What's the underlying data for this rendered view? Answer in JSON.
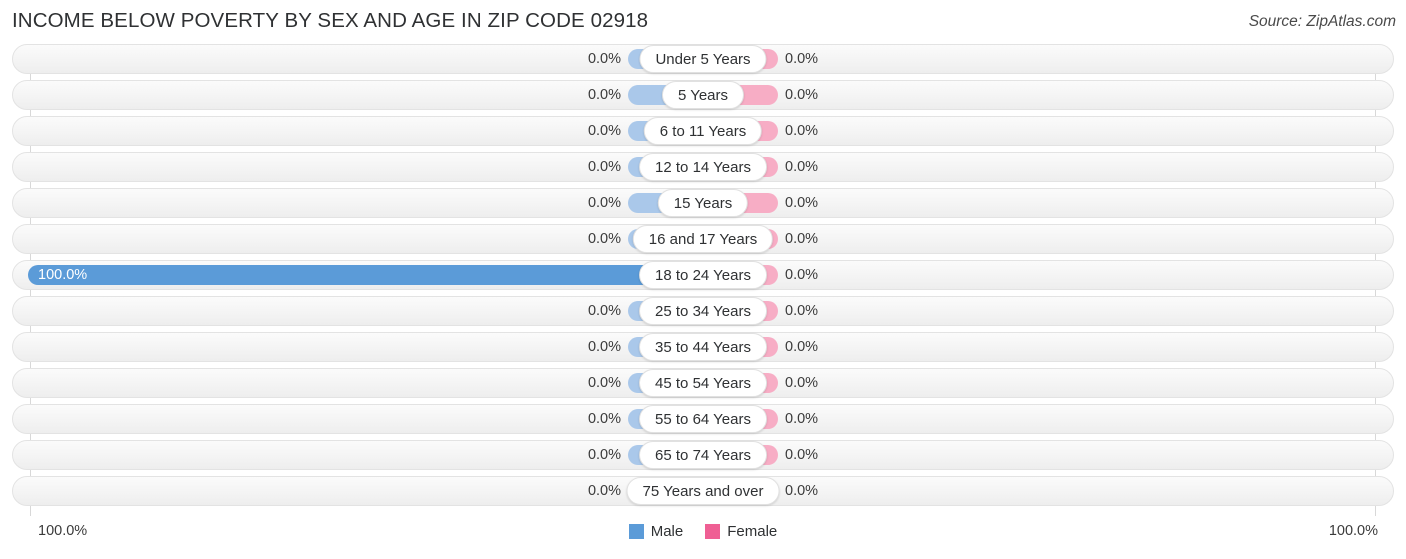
{
  "header": {
    "title": "INCOME BELOW POVERTY BY SEX AND AGE IN ZIP CODE 02918",
    "source": "Source: ZipAtlas.com"
  },
  "footer": {
    "axis_left": "100.0%",
    "axis_right": "100.0%",
    "legend": [
      {
        "label": "Male",
        "color": "#5b9bd8"
      },
      {
        "label": "Female",
        "color": "#ef5f94"
      }
    ]
  },
  "colors": {
    "male_bar": "#aac8ea",
    "male_bar_highlight": "#5b9bd8",
    "female_bar": "#f7adc5",
    "track": "#f4f4f4",
    "axis": "#d8d8d8"
  },
  "chart_data": {
    "type": "bar",
    "title": "INCOME BELOW POVERTY BY SEX AND AGE IN ZIP CODE 02918",
    "orientation": "horizontal-diverging",
    "xlabel": "",
    "ylabel": "",
    "xlim": [
      0,
      100
    ],
    "grid": false,
    "legend_position": "bottom-center",
    "categories": [
      "Under 5 Years",
      "5 Years",
      "6 to 11 Years",
      "12 to 14 Years",
      "15 Years",
      "16 and 17 Years",
      "18 to 24 Years",
      "25 to 34 Years",
      "35 to 44 Years",
      "45 to 54 Years",
      "55 to 64 Years",
      "65 to 74 Years",
      "75 Years and over"
    ],
    "series": [
      {
        "name": "Male",
        "values": [
          0.0,
          0.0,
          0.0,
          0.0,
          0.0,
          0.0,
          100.0,
          0.0,
          0.0,
          0.0,
          0.0,
          0.0,
          0.0
        ],
        "labels": [
          "0.0%",
          "0.0%",
          "0.0%",
          "0.0%",
          "0.0%",
          "0.0%",
          "100.0%",
          "0.0%",
          "0.0%",
          "0.0%",
          "0.0%",
          "0.0%",
          "0.0%"
        ]
      },
      {
        "name": "Female",
        "values": [
          0.0,
          0.0,
          0.0,
          0.0,
          0.0,
          0.0,
          0.0,
          0.0,
          0.0,
          0.0,
          0.0,
          0.0,
          0.0
        ],
        "labels": [
          "0.0%",
          "0.0%",
          "0.0%",
          "0.0%",
          "0.0%",
          "0.0%",
          "0.0%",
          "0.0%",
          "0.0%",
          "0.0%",
          "0.0%",
          "0.0%",
          "0.0%"
        ]
      }
    ]
  },
  "rows": [
    {
      "label": "Under 5 Years",
      "male_label": "0.0%",
      "female_label": "0.0%",
      "male_value": 0.0,
      "female_value": 0.0,
      "highlight": false
    },
    {
      "label": "5 Years",
      "male_label": "0.0%",
      "female_label": "0.0%",
      "male_value": 0.0,
      "female_value": 0.0,
      "highlight": false
    },
    {
      "label": "6 to 11 Years",
      "male_label": "0.0%",
      "female_label": "0.0%",
      "male_value": 0.0,
      "female_value": 0.0,
      "highlight": false
    },
    {
      "label": "12 to 14 Years",
      "male_label": "0.0%",
      "female_label": "0.0%",
      "male_value": 0.0,
      "female_value": 0.0,
      "highlight": false
    },
    {
      "label": "15 Years",
      "male_label": "0.0%",
      "female_label": "0.0%",
      "male_value": 0.0,
      "female_value": 0.0,
      "highlight": false
    },
    {
      "label": "16 and 17 Years",
      "male_label": "0.0%",
      "female_label": "0.0%",
      "male_value": 0.0,
      "female_value": 0.0,
      "highlight": false
    },
    {
      "label": "18 to 24 Years",
      "male_label": "100.0%",
      "female_label": "0.0%",
      "male_value": 100.0,
      "female_value": 0.0,
      "highlight": true
    },
    {
      "label": "25 to 34 Years",
      "male_label": "0.0%",
      "female_label": "0.0%",
      "male_value": 0.0,
      "female_value": 0.0,
      "highlight": false
    },
    {
      "label": "35 to 44 Years",
      "male_label": "0.0%",
      "female_label": "0.0%",
      "male_value": 0.0,
      "female_value": 0.0,
      "highlight": false
    },
    {
      "label": "45 to 54 Years",
      "male_label": "0.0%",
      "female_label": "0.0%",
      "male_value": 0.0,
      "female_value": 0.0,
      "highlight": false
    },
    {
      "label": "55 to 64 Years",
      "male_label": "0.0%",
      "female_label": "0.0%",
      "male_value": 0.0,
      "female_value": 0.0,
      "highlight": false
    },
    {
      "label": "65 to 74 Years",
      "male_label": "0.0%",
      "female_label": "0.0%",
      "male_value": 0.0,
      "female_value": 0.0,
      "highlight": false
    },
    {
      "label": "75 Years and over",
      "male_label": "0.0%",
      "female_label": "0.0%",
      "male_value": 0.0,
      "female_value": 0.0,
      "highlight": false
    }
  ]
}
